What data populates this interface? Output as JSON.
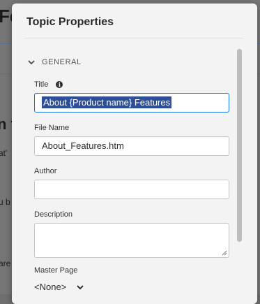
{
  "background": {
    "title_fragment": "Fe",
    "heading_fragment": "n t",
    "text1": "at'",
    "text2": "u b",
    "text3": "are"
  },
  "dialog": {
    "title": "Topic Properties",
    "section": "GENERAL",
    "fields": {
      "title_label": "Title",
      "title_value": "About {Product name} Features",
      "file_name_label": "File Name",
      "file_name_value": "About_Features.htm",
      "author_label": "Author",
      "author_value": "",
      "description_label": "Description",
      "description_value": "",
      "master_page_label": "Master Page",
      "master_page_value": "<None>"
    }
  },
  "colors": {
    "focus_border": "#1473e6",
    "selection": "#2d4f99"
  },
  "icons": {
    "section_toggle": "chevron-down-icon",
    "title_info": "info-icon",
    "master_page_caret": "chevron-down-icon"
  }
}
